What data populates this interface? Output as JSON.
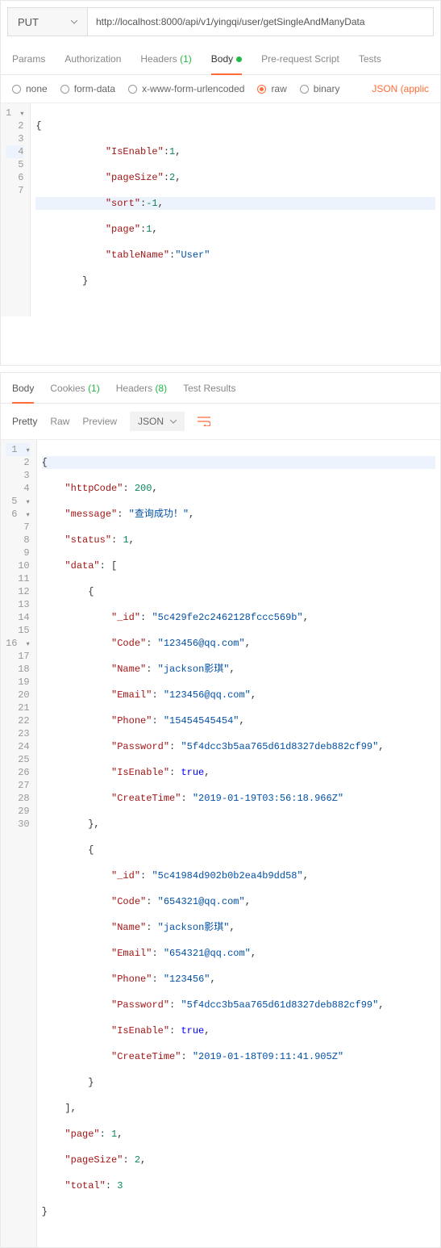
{
  "request": {
    "method": "PUT",
    "url": "http://localhost:8000/api/v1/yingqi/user/getSingleAndManyData"
  },
  "tabs": {
    "params": "Params",
    "auth": "Authorization",
    "headers": "Headers",
    "headersCount": "(1)",
    "body": "Body",
    "prereq": "Pre-request Script",
    "tests": "Tests"
  },
  "bodyTypes": {
    "none": "none",
    "formData": "form-data",
    "urlenc": "x-www-form-urlencoded",
    "raw": "raw",
    "binary": "binary",
    "jsonType": "JSON (applic"
  },
  "reqBody": {
    "l1": "{",
    "l2a": "            \"IsEnable\"",
    "l2b": ":",
    "l2c": "1",
    "l2d": ",",
    "l3a": "            \"pageSize\"",
    "l3b": ":",
    "l3c": "2",
    "l3d": ",",
    "l4a": "            \"sort\"",
    "l4b": ":",
    "l4c": "-1",
    "l4d": ",",
    "l5a": "            \"page\"",
    "l5b": ":",
    "l5c": "1",
    "l5d": ",",
    "l6a": "            \"tableName\"",
    "l6b": ":",
    "l6c": "\"User\"",
    "l7": "        }"
  },
  "respTabs": {
    "body": "Body",
    "cookies": "Cookies",
    "cookiesCount": "(1)",
    "headers": "Headers",
    "headersCount": "(8)",
    "tests": "Test Results"
  },
  "viewBar": {
    "pretty": "Pretty",
    "raw": "Raw",
    "preview": "Preview",
    "format": "JSON"
  },
  "resp": {
    "l1": "{",
    "l2k": "\"httpCode\"",
    "l2v": "200",
    "l3k": "\"message\"",
    "l3v": "\"查询成功！\"",
    "l4k": "\"status\"",
    "l4v": "1",
    "l5k": "\"data\"",
    "l7k": "\"_id\"",
    "l7v": "\"5c429fe2c2462128fccc569b\"",
    "l8k": "\"Code\"",
    "l8v": "\"123456@qq.com\"",
    "l9k": "\"Name\"",
    "l9v": "\"jackson影琪\"",
    "l10k": "\"Email\"",
    "l10v": "\"123456@qq.com\"",
    "l11k": "\"Phone\"",
    "l11v": "\"15454545454\"",
    "l12k": "\"Password\"",
    "l12v": "\"5f4dcc3b5aa765d61d8327deb882cf99\"",
    "l13k": "\"IsEnable\"",
    "l13v": "true",
    "l14k": "\"CreateTime\"",
    "l14v": "\"2019-01-19T03:56:18.966Z\"",
    "l17k": "\"_id\"",
    "l17v": "\"5c41984d902b0b2ea4b9dd58\"",
    "l18k": "\"Code\"",
    "l18v": "\"654321@qq.com\"",
    "l19k": "\"Name\"",
    "l19v": "\"jackson影琪\"",
    "l20k": "\"Email\"",
    "l20v": "\"654321@qq.com\"",
    "l21k": "\"Phone\"",
    "l21v": "\"123456\"",
    "l22k": "\"Password\"",
    "l22v": "\"5f4dcc3b5aa765d61d8327deb882cf99\"",
    "l23k": "\"IsEnable\"",
    "l23v": "true",
    "l24k": "\"CreateTime\"",
    "l24v": "\"2019-01-18T09:11:41.905Z\"",
    "l27k": "\"page\"",
    "l27v": "1",
    "l28k": "\"pageSize\"",
    "l28v": "2",
    "l29k": "\"total\"",
    "l29v": "3"
  },
  "gut": {
    "g1": "1",
    "g2": "2",
    "g3": "3",
    "g4": "4",
    "g5": "5",
    "g6": "6",
    "g7": "7",
    "g8": "8",
    "g9": "9",
    "g10": "10",
    "g11": "11",
    "g12": "12",
    "g13": "13",
    "g14": "14",
    "g15": "15",
    "g16": "16",
    "g17": "17",
    "g18": "18",
    "g19": "19",
    "g20": "20",
    "g21": "21",
    "g22": "22",
    "g23": "23",
    "g24": "24",
    "g25": "25",
    "g26": "26",
    "g27": "27",
    "g28": "28",
    "g29": "29",
    "g30": "30"
  }
}
